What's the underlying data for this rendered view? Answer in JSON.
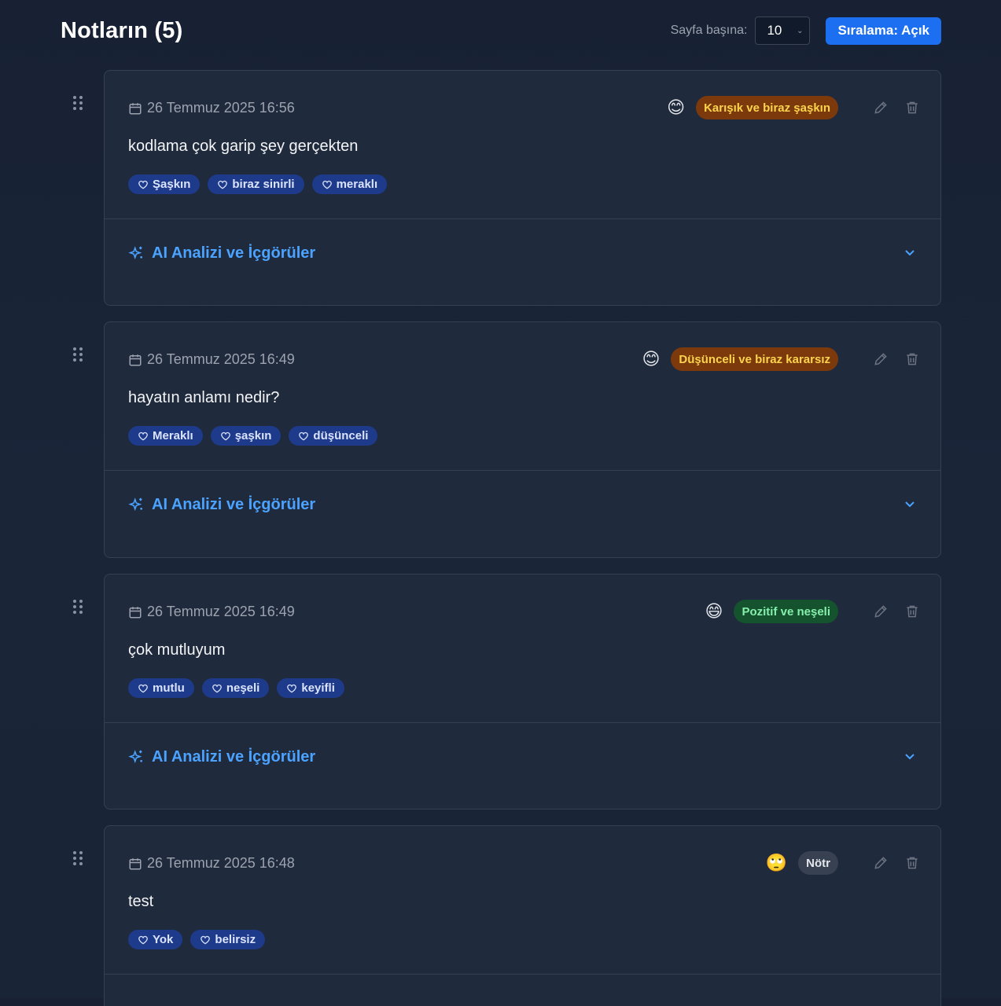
{
  "header": {
    "title": "Notların (5)",
    "per_page_label": "Sayfa başına:",
    "per_page_value": "10",
    "sort_button": "Sıralama: Açık"
  },
  "ai_label": "AI Analizi ve İçgörüler",
  "notes": [
    {
      "date": "26 Temmuz 2025 16:56",
      "emoji": "😊",
      "mood": "Karışık ve biraz şaşkın",
      "mood_color": "orange",
      "text": "kodlama çok garip şey gerçekten",
      "tags": [
        "Şaşkın",
        "biraz sinirli",
        "meraklı"
      ]
    },
    {
      "date": "26 Temmuz 2025 16:49",
      "emoji": "😊",
      "mood": "Düşünceli ve biraz kararsız",
      "mood_color": "orange",
      "text": "hayatın anlamı nedir?",
      "tags": [
        "Meraklı",
        "şaşkın",
        "düşünceli"
      ]
    },
    {
      "date": "26 Temmuz 2025 16:49",
      "emoji": "😄",
      "mood": "Pozitif ve neşeli",
      "mood_color": "green",
      "text": "çok mutluyum",
      "tags": [
        "mutlu",
        "neşeli",
        "keyifli"
      ]
    },
    {
      "date": "26 Temmuz 2025 16:48",
      "emoji": "🙄",
      "mood": "Nötr",
      "mood_color": "gray",
      "text": "test",
      "tags": [
        "Yok",
        "belirsiz"
      ]
    }
  ],
  "colors": {
    "accent": "#1d6ff2",
    "ai_link": "#4ba3ff",
    "tag_bg": "#1e3a8a",
    "card_bg": "#1f2a3d"
  }
}
